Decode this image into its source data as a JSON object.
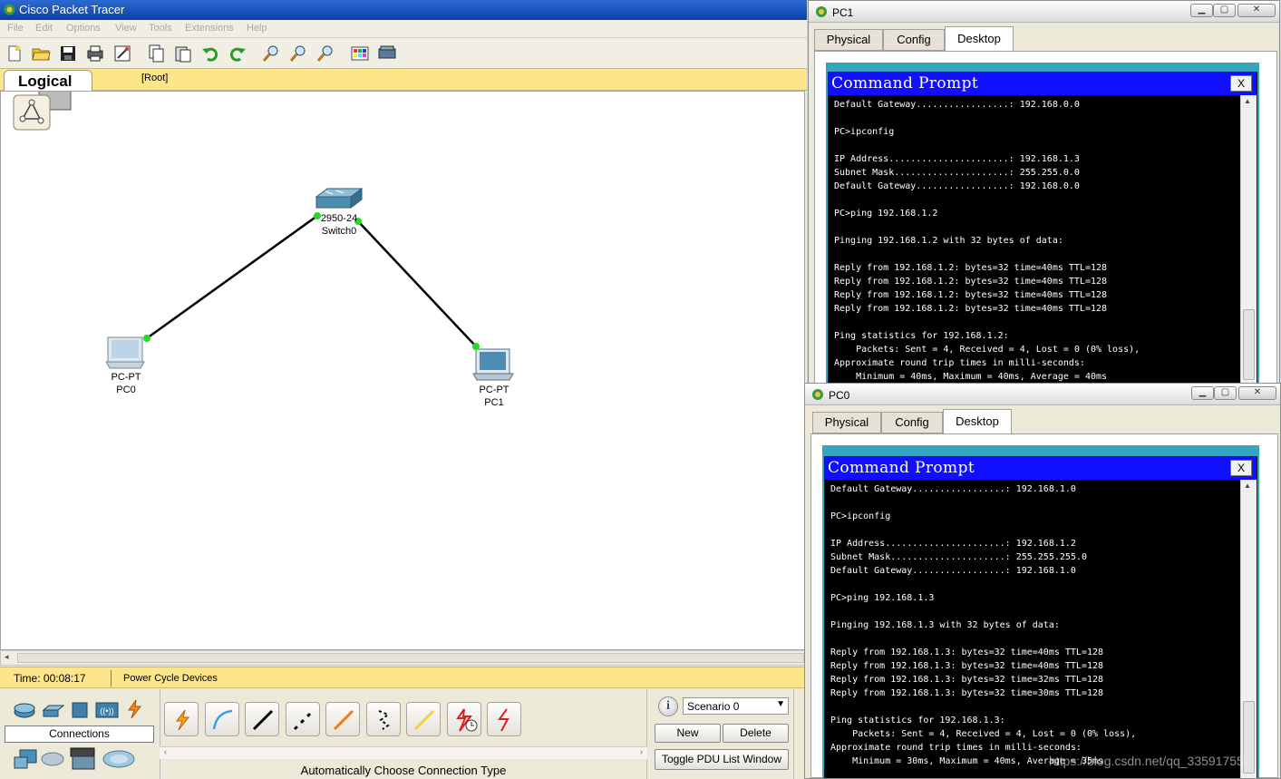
{
  "main": {
    "title": "Cisco Packet Tracer",
    "menu": [
      "File",
      "Edit",
      "Options",
      "View",
      "Tools",
      "Extensions",
      "Help"
    ],
    "logical_tab": "Logical",
    "root_label": "[Root]",
    "status": {
      "time": "Time: 00:08:17",
      "power_cycle": "Power Cycle Devices"
    },
    "connections_label": "Connections",
    "auto_connection": "Automatically Choose Connection Type",
    "scenario": {
      "selected": "Scenario 0",
      "new_label": "New",
      "delete_label": "Delete",
      "toggle_label": "Toggle PDU List Window"
    }
  },
  "topology": {
    "switch": {
      "model": "2950-24",
      "name": "Switch0"
    },
    "pc0": {
      "model": "PC-PT",
      "name": "PC0"
    },
    "pc1": {
      "model": "PC-PT",
      "name": "PC1"
    },
    "link_color": "#000000",
    "port_color": "#22dd22"
  },
  "pc1_window": {
    "title": "PC1",
    "tabs": [
      "Physical",
      "Config",
      "Desktop"
    ],
    "active_tab": "Desktop",
    "cmd_title": "Command Prompt",
    "cmd_close": "X",
    "lines": [
      "Default Gateway.................: 192.168.0.0",
      "",
      "PC>ipconfig",
      "",
      "IP Address......................: 192.168.1.3",
      "Subnet Mask.....................: 255.255.0.0",
      "Default Gateway.................: 192.168.0.0",
      "",
      "PC>ping 192.168.1.2",
      "",
      "Pinging 192.168.1.2 with 32 bytes of data:",
      "",
      "Reply from 192.168.1.2: bytes=32 time=40ms TTL=128",
      "Reply from 192.168.1.2: bytes=32 time=40ms TTL=128",
      "Reply from 192.168.1.2: bytes=32 time=40ms TTL=128",
      "Reply from 192.168.1.2: bytes=32 time=40ms TTL=128",
      "",
      "Ping statistics for 192.168.1.2:",
      "    Packets: Sent = 4, Received = 4, Lost = 0 (0% loss),",
      "Approximate round trip times in milli-seconds:",
      "    Minimum = 40ms, Maximum = 40ms, Average = 40ms"
    ]
  },
  "pc0_window": {
    "title": "PC0",
    "tabs": [
      "Physical",
      "Config",
      "Desktop"
    ],
    "active_tab": "Desktop",
    "cmd_title": "Command Prompt",
    "cmd_close": "X",
    "lines": [
      "Default Gateway.................: 192.168.1.0",
      "",
      "PC>ipconfig",
      "",
      "IP Address......................: 192.168.1.2",
      "Subnet Mask.....................: 255.255.255.0",
      "Default Gateway.................: 192.168.1.0",
      "",
      "PC>ping 192.168.1.3",
      "",
      "Pinging 192.168.1.3 with 32 bytes of data:",
      "",
      "Reply from 192.168.1.3: bytes=32 time=40ms TTL=128",
      "Reply from 192.168.1.3: bytes=32 time=40ms TTL=128",
      "Reply from 192.168.1.3: bytes=32 time=32ms TTL=128",
      "Reply from 192.168.1.3: bytes=32 time=30ms TTL=128",
      "",
      "Ping statistics for 192.168.1.3:",
      "    Packets: Sent = 4, Received = 4, Lost = 0 (0% loss),",
      "Approximate round trip times in milli-seconds:",
      "    Minimum = 30ms, Maximum = 40ms, Average = 35ms"
    ]
  },
  "watermark": "https://blog.csdn.net/qq_33591755"
}
